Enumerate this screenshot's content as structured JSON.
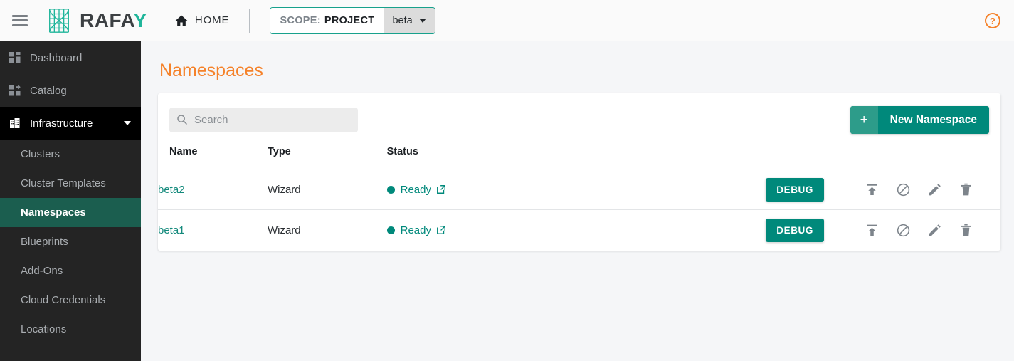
{
  "topbar": {
    "menu_icon": "hamburger-menu-icon",
    "brand": {
      "text_main": "RAFA",
      "text_accent": "Y",
      "logo_icon": "rafay-lattice-logo"
    },
    "home": {
      "icon": "home-icon",
      "label": "HOME"
    },
    "scope": {
      "key_label": "SCOPE:",
      "value_label": "PROJECT",
      "selected_project": "beta",
      "caret_icon": "chevron-down-icon"
    },
    "help": {
      "icon": "help-circle-icon",
      "color": "#f5822a"
    }
  },
  "sidebar": {
    "items": [
      {
        "label": "Dashboard",
        "icon": "dashboard-grid-icon",
        "active": false
      },
      {
        "label": "Catalog",
        "icon": "catalog-grid-icon",
        "active": false
      },
      {
        "label": "Infrastructure",
        "icon": "building-icon",
        "active": true,
        "expanded": true
      }
    ],
    "sub_items": [
      {
        "label": "Clusters",
        "selected": false
      },
      {
        "label": "Cluster Templates",
        "selected": false
      },
      {
        "label": "Namespaces",
        "selected": true
      },
      {
        "label": "Blueprints",
        "selected": false
      },
      {
        "label": "Add-Ons",
        "selected": false
      },
      {
        "label": "Cloud Credentials",
        "selected": false
      },
      {
        "label": "Locations",
        "selected": false
      }
    ],
    "colors": {
      "background": "#242424",
      "active_group": "#000000",
      "selected": "#1b5e4f"
    }
  },
  "main": {
    "page_title": "Namespaces",
    "title_color": "#f5822a",
    "search": {
      "placeholder": "Search",
      "value": "",
      "icon": "search-icon"
    },
    "new_button": {
      "plus_label": "+",
      "label": "New Namespace",
      "color": "#00897b"
    },
    "table": {
      "columns": [
        "Name",
        "Type",
        "Status",
        ""
      ],
      "rows": [
        {
          "name": "beta2",
          "type": "Wizard",
          "status": "Ready",
          "status_color": "#00897b",
          "debug_label": "DEBUG",
          "actions": [
            "publish-icon",
            "block-icon",
            "edit-pencil-icon",
            "delete-trash-icon"
          ]
        },
        {
          "name": "beta1",
          "type": "Wizard",
          "status": "Ready",
          "status_color": "#00897b",
          "debug_label": "DEBUG",
          "actions": [
            "publish-icon",
            "block-icon",
            "edit-pencil-icon",
            "delete-trash-icon"
          ]
        }
      ]
    }
  }
}
